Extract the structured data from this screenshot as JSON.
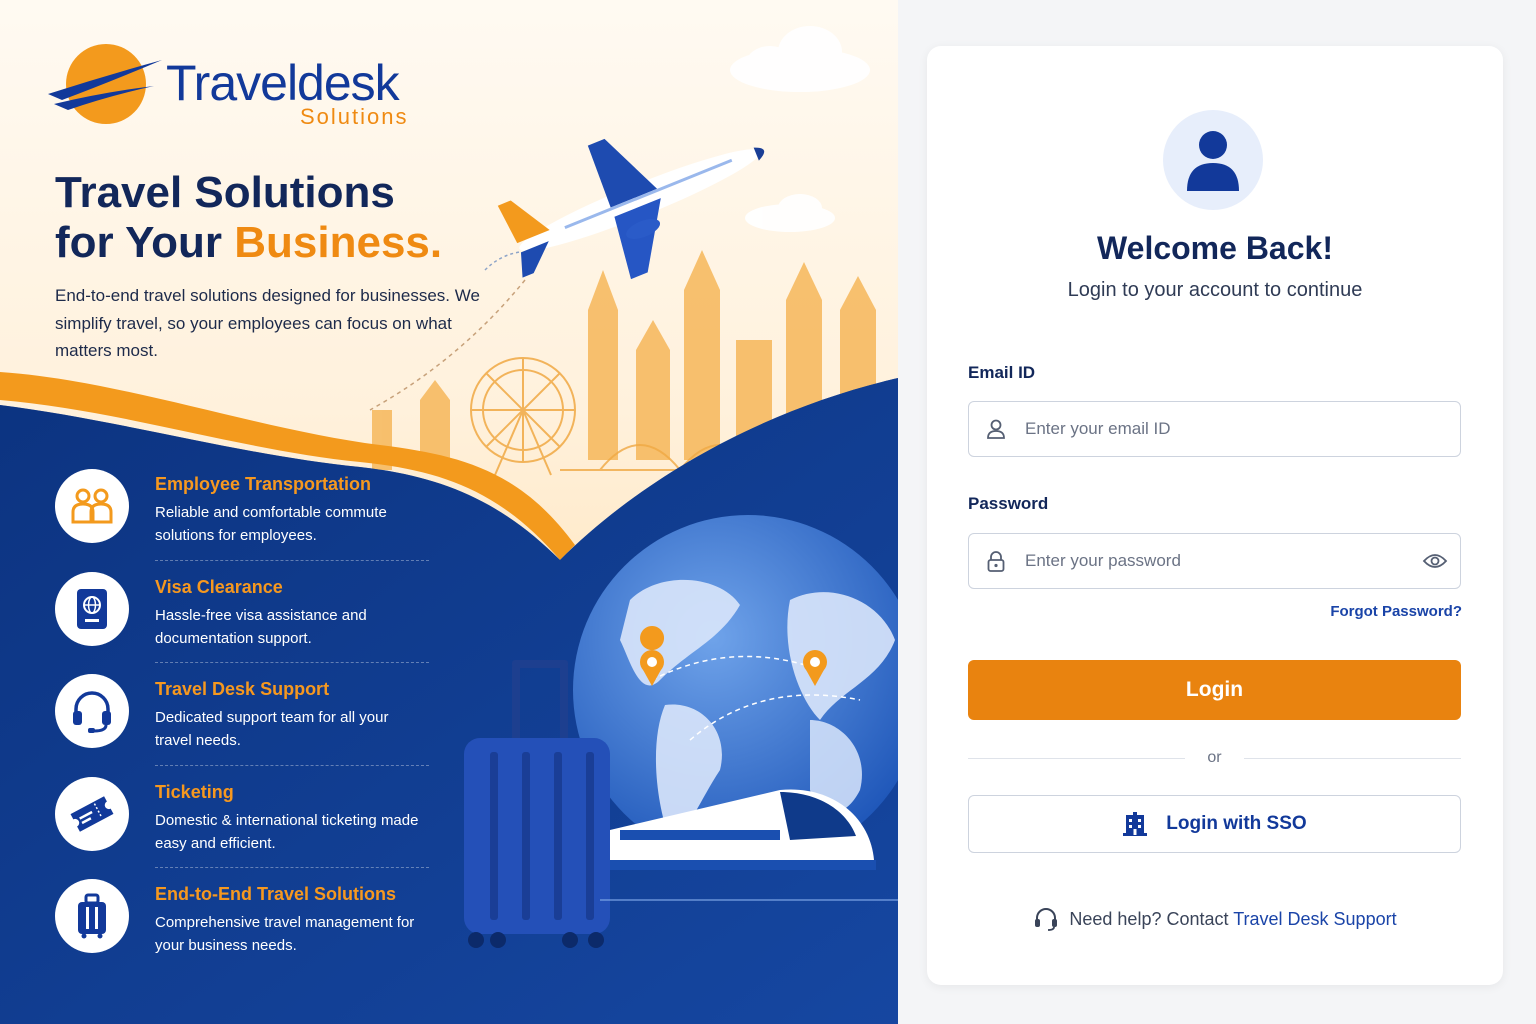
{
  "brand": {
    "name": "Traveldesk",
    "sub": "Solutions"
  },
  "hero": {
    "title_line1": "Travel Solutions",
    "title_line2_prefix": "for Your ",
    "title_line2_accent": "Business.",
    "description": "End-to-end travel solutions designed for businesses. We simplify travel, so your employees can focus on what matters most."
  },
  "features": [
    {
      "title": "Employee Transportation",
      "desc": "Reliable and comfortable commute solutions for employees.",
      "icon": "people-icon"
    },
    {
      "title": "Visa Clearance",
      "desc": "Hassle-free visa assistance and documentation support.",
      "icon": "passport-icon"
    },
    {
      "title": "Travel Desk Support",
      "desc": "Dedicated support team for all your travel needs.",
      "icon": "headset-icon"
    },
    {
      "title": "Ticketing",
      "desc": "Domestic & international ticketing made easy and efficient.",
      "icon": "ticket-icon"
    },
    {
      "title": "End-to-End Travel Solutions",
      "desc": "Comprehensive travel management for your business needs.",
      "icon": "luggage-icon"
    }
  ],
  "login": {
    "welcome": "Welcome Back!",
    "subtitle": "Login to your account to continue",
    "email_label": "Email ID",
    "email_placeholder": "Enter your email ID",
    "email_value": "",
    "password_label": "Password",
    "password_placeholder": "Enter your password",
    "password_value": "",
    "forgot": "Forgot Password?",
    "login_button": "Login",
    "or": "or",
    "sso_button": "Login with SSO",
    "help_prefix": "Need help? Contact ",
    "help_link": "Travel Desk Support"
  },
  "colors": {
    "navy": "#12275a",
    "brand_blue": "#12399a",
    "orange": "#e9830f",
    "deep_blue_panel": "#0e3a8c"
  }
}
